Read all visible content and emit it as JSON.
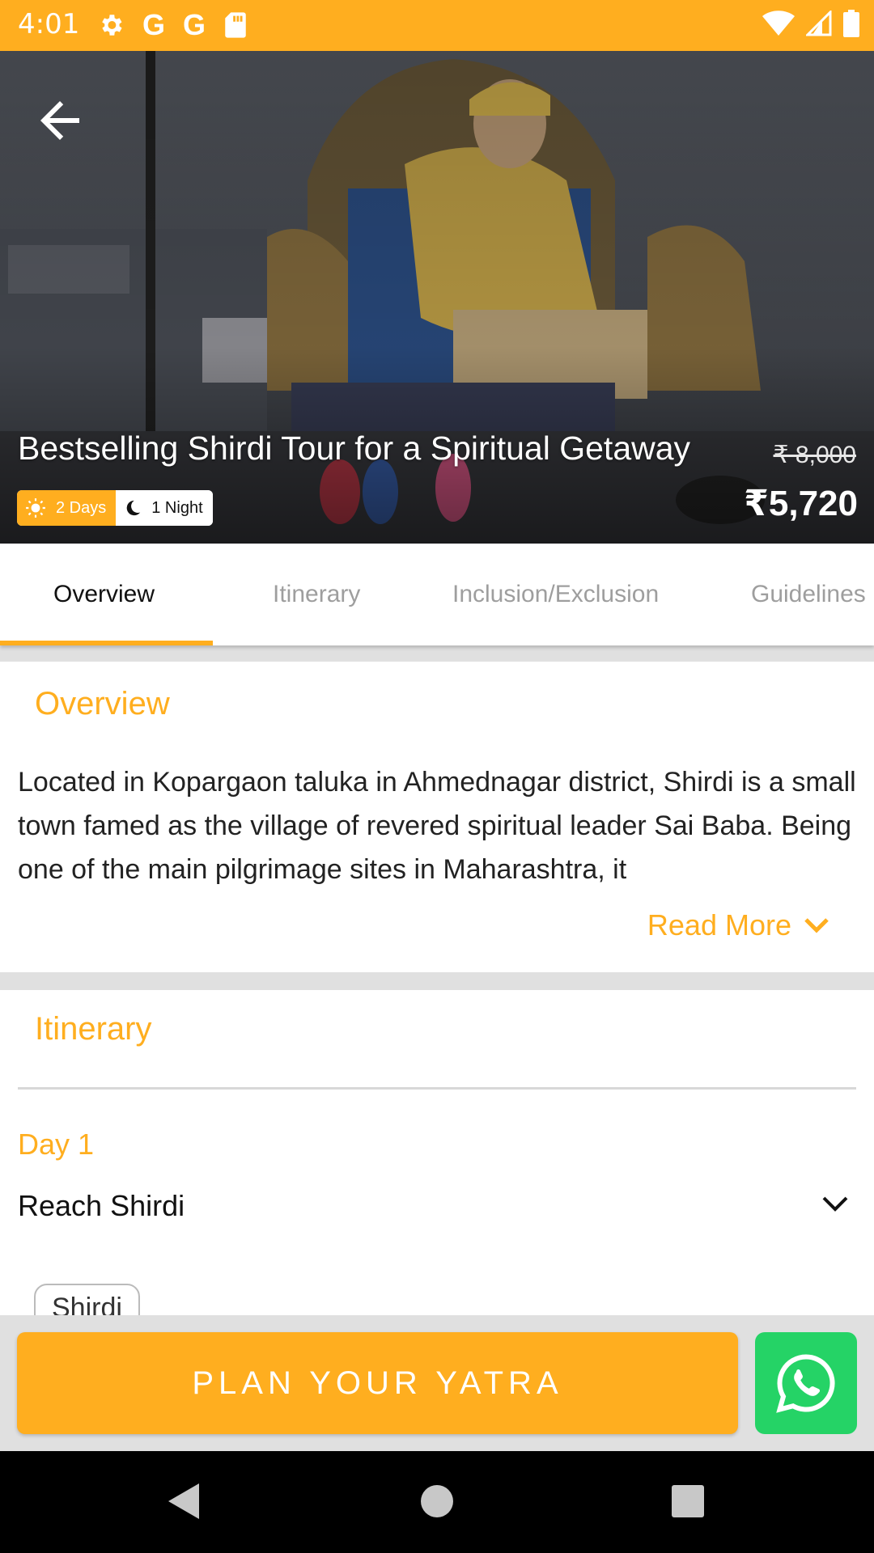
{
  "status_bar": {
    "time": "4:01",
    "left_icons": [
      "gear-icon",
      "google-icon",
      "google-icon",
      "sd-card-icon"
    ],
    "right_icons": [
      "wifi-icon",
      "signal-icon",
      "battery-icon"
    ]
  },
  "hero": {
    "title": "Bestselling Shirdi Tour for a Spiritual Getaway",
    "old_price": "₹ 8,000",
    "price": "₹5,720",
    "days_label": "2 Days",
    "nights_label": "1 Night"
  },
  "tabs": [
    {
      "label": "Overview",
      "active": true
    },
    {
      "label": "Itinerary",
      "active": false
    },
    {
      "label": "Inclusion/Exclusion",
      "active": false
    },
    {
      "label": "Guidelines",
      "active": false
    }
  ],
  "overview": {
    "heading": "Overview",
    "text": "Located in Kopargaon taluka in Ahmednagar district, Shirdi is a small town famed as the village of revered spiritual leader Sai Baba. Being one of the main pilgrimage sites in Maharashtra, it",
    "read_more": "Read More"
  },
  "itinerary": {
    "heading": "Itinerary",
    "day_label": "Day 1",
    "day_title": "Reach Shirdi",
    "place_chip": "Shirdi"
  },
  "bottom": {
    "plan_label": "PLAN YOUR YATRA"
  },
  "colors": {
    "accent": "#FFAE1F",
    "whatsapp": "#25D366"
  }
}
